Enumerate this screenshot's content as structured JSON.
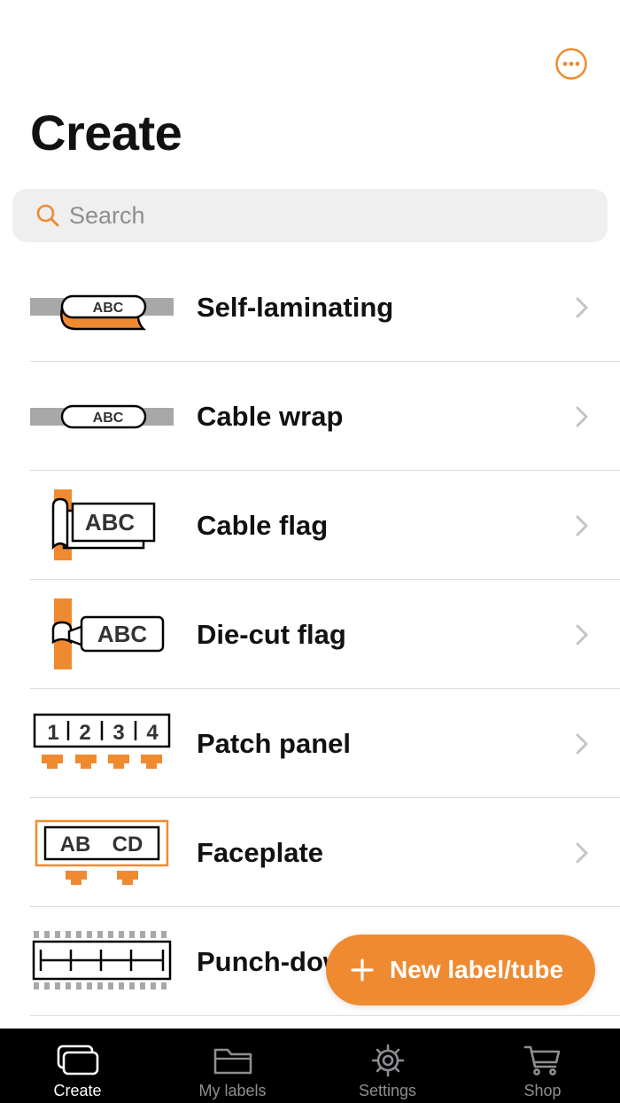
{
  "header": {
    "title": "Create",
    "more_icon": "ellipsis-circle-icon"
  },
  "search": {
    "placeholder": "Search",
    "value": "",
    "icon": "search-icon"
  },
  "categories": [
    {
      "label": "Self-laminating",
      "illustration_text": "ABC",
      "icon": "self-laminating-illustration"
    },
    {
      "label": "Cable wrap",
      "illustration_text": "ABC",
      "icon": "cable-wrap-illustration"
    },
    {
      "label": "Cable flag",
      "illustration_text": "ABC",
      "icon": "cable-flag-illustration"
    },
    {
      "label": "Die-cut flag",
      "illustration_text": "ABC",
      "icon": "die-cut-flag-illustration"
    },
    {
      "label": "Patch panel",
      "illustration_ports": [
        "1",
        "2",
        "3",
        "4"
      ],
      "icon": "patch-panel-illustration"
    },
    {
      "label": "Faceplate",
      "illustration_text": [
        "AB",
        "CD"
      ],
      "icon": "faceplate-illustration"
    },
    {
      "label": "Punch-down",
      "icon": "punch-down-illustration"
    }
  ],
  "fab": {
    "label": "New label/tube",
    "icon": "plus-icon"
  },
  "tabbar": {
    "tabs": [
      {
        "label": "Create",
        "icon": "create-stack-icon",
        "active": true
      },
      {
        "label": "My labels",
        "icon": "folder-icon",
        "active": false
      },
      {
        "label": "Settings",
        "icon": "gear-icon",
        "active": false
      },
      {
        "label": "Shop",
        "icon": "cart-icon",
        "active": false
      }
    ]
  },
  "colors": {
    "accent": "#f08a30",
    "text": "#111111",
    "search_bg": "#efefef",
    "separator": "#dcdcdc",
    "tabbar_bg": "#000000",
    "tab_inactive": "#8e8e93",
    "cable_gray": "#a8a8a8"
  }
}
